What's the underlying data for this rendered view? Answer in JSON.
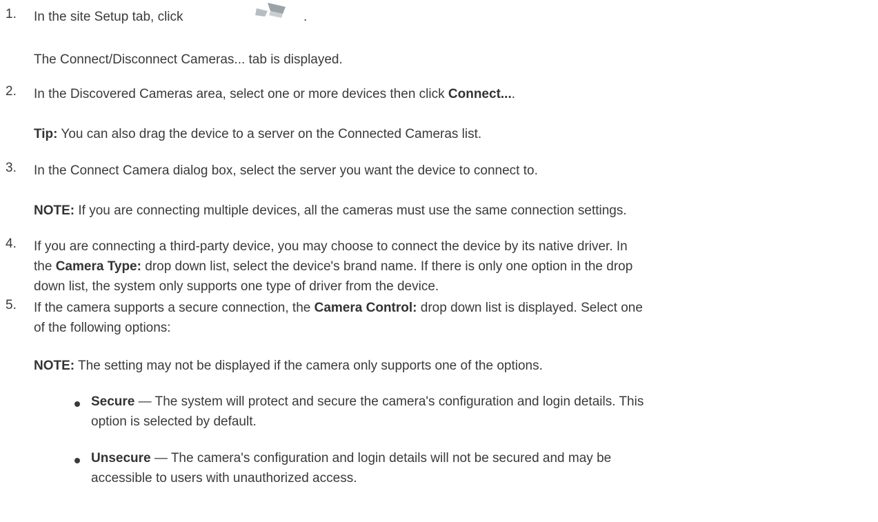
{
  "steps": [
    {
      "num": "1.",
      "pre": "In the site Setup tab, click",
      "post": "."
    },
    {
      "sub": "The Connect/Disconnect Cameras... tab is displayed."
    },
    {
      "num": "2.",
      "pre": "In the Discovered Cameras area, select one or more devices then click ",
      "bold": "Connect...",
      "post": "."
    },
    {
      "tip_label": "Tip:",
      "tip_text": " You can also drag the device to a server on the Connected Cameras list."
    },
    {
      "num": "3.",
      "text": "In the Connect Camera dialog box, select the server you want the device to connect to."
    },
    {
      "note_label": "NOTE:",
      "note_text": " If you are connecting multiple devices, all the cameras must use the same connection settings."
    },
    {
      "num": "4.",
      "line1": "If you are connecting a third-party device, you may choose to connect the device by its native driver. In",
      "line2_pre": "the ",
      "line2_bold": "Camera Type:",
      "line2_post": " drop down list, select the device's brand name. If there is only one option in the drop",
      "line3": "down list, the system only supports one type of driver from the device."
    },
    {
      "num": "5.",
      "line1_pre": "If the camera supports a secure connection, the ",
      "line1_bold": "Camera Control:",
      "line1_post": " drop down list is displayed. Select one",
      "line2": "of the following options:"
    },
    {
      "note_label": "NOTE:",
      "note_text": " The setting may not be displayed if the camera only supports one of the options."
    }
  ],
  "bullets": [
    {
      "bold": "Secure",
      "line1": " — The system will protect and secure the camera's configuration and login details. This",
      "line2": "option is selected by default."
    },
    {
      "bold": "Unsecure",
      "line1": " — The camera's configuration and login details will not be secured and may be",
      "line2": "accessible to users with unauthorized access."
    }
  ],
  "icon": {
    "name": "camera-connect-icon",
    "color": "#9aa3a8"
  }
}
